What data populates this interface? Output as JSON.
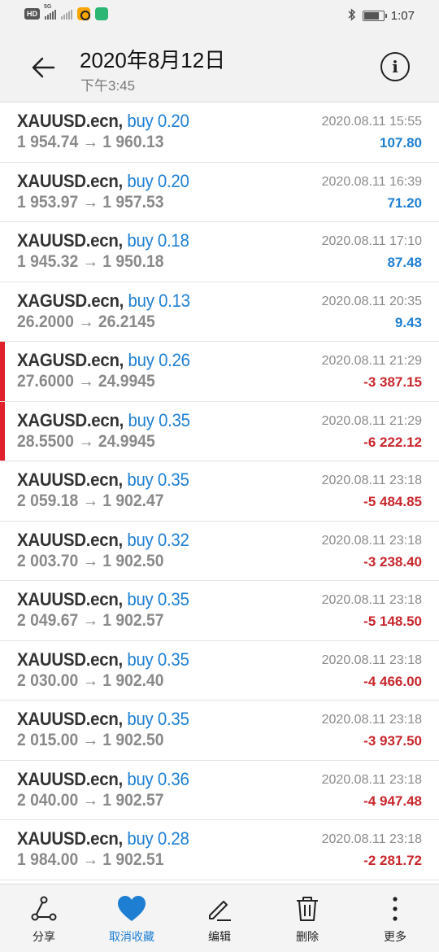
{
  "status_bar": {
    "network_label": "HD",
    "signal_label": "5G",
    "time": "1:07"
  },
  "header": {
    "title": "2020年8月12日",
    "subtitle": "下午3:45"
  },
  "trades": [
    {
      "symbol": "XAUUSD.ecn,",
      "side": "buy 0.20",
      "prices": "1 954.74 → 1 960.13",
      "time": "2020.08.11 15:55",
      "profit": "107.80",
      "positive": true,
      "flag": false
    },
    {
      "symbol": "XAUUSD.ecn,",
      "side": "buy 0.20",
      "prices": "1 953.97 → 1 957.53",
      "time": "2020.08.11 16:39",
      "profit": "71.20",
      "positive": true,
      "flag": false
    },
    {
      "symbol": "XAUUSD.ecn,",
      "side": "buy 0.18",
      "prices": "1 945.32 → 1 950.18",
      "time": "2020.08.11 17:10",
      "profit": "87.48",
      "positive": true,
      "flag": false
    },
    {
      "symbol": "XAGUSD.ecn,",
      "side": "buy 0.13",
      "prices": "26.2000 → 26.2145",
      "time": "2020.08.11 20:35",
      "profit": "9.43",
      "positive": true,
      "flag": false
    },
    {
      "symbol": "XAGUSD.ecn,",
      "side": "buy 0.26",
      "prices": "27.6000 → 24.9945",
      "time": "2020.08.11 21:29",
      "profit": "-3 387.15",
      "positive": false,
      "flag": true
    },
    {
      "symbol": "XAGUSD.ecn,",
      "side": "buy 0.35",
      "prices": "28.5500 → 24.9945",
      "time": "2020.08.11 21:29",
      "profit": "-6 222.12",
      "positive": false,
      "flag": true
    },
    {
      "symbol": "XAUUSD.ecn,",
      "side": "buy 0.35",
      "prices": "2 059.18 → 1 902.47",
      "time": "2020.08.11 23:18",
      "profit": "-5 484.85",
      "positive": false,
      "flag": false
    },
    {
      "symbol": "XAUUSD.ecn,",
      "side": "buy 0.32",
      "prices": "2 003.70 → 1 902.50",
      "time": "2020.08.11 23:18",
      "profit": "-3 238.40",
      "positive": false,
      "flag": false
    },
    {
      "symbol": "XAUUSD.ecn,",
      "side": "buy 0.35",
      "prices": "2 049.67 → 1 902.57",
      "time": "2020.08.11 23:18",
      "profit": "-5 148.50",
      "positive": false,
      "flag": false
    },
    {
      "symbol": "XAUUSD.ecn,",
      "side": "buy 0.35",
      "prices": "2 030.00 → 1 902.40",
      "time": "2020.08.11 23:18",
      "profit": "-4 466.00",
      "positive": false,
      "flag": false
    },
    {
      "symbol": "XAUUSD.ecn,",
      "side": "buy 0.35",
      "prices": "2 015.00 → 1 902.50",
      "time": "2020.08.11 23:18",
      "profit": "-3 937.50",
      "positive": false,
      "flag": false
    },
    {
      "symbol": "XAUUSD.ecn,",
      "side": "buy 0.36",
      "prices": "2 040.00 → 1 902.57",
      "time": "2020.08.11 23:18",
      "profit": "-4 947.48",
      "positive": false,
      "flag": false
    },
    {
      "symbol": "XAUUSD.ecn,",
      "side": "buy 0.28",
      "prices": "1 984.00 → 1 902.51",
      "time": "2020.08.11 23:18",
      "profit": "-2 281.72",
      "positive": false,
      "flag": false
    }
  ],
  "bottom_bar": [
    {
      "label": "分享",
      "icon": "share-icon",
      "active": false
    },
    {
      "label": "取消收藏",
      "icon": "heart-icon",
      "active": true
    },
    {
      "label": "编辑",
      "icon": "edit-icon",
      "active": false
    },
    {
      "label": "删除",
      "icon": "trash-icon",
      "active": false
    },
    {
      "label": "更多",
      "icon": "more-icon",
      "active": false
    }
  ],
  "colors": {
    "positive": "#1e7fd2",
    "negative": "#c8262c",
    "flag": "#e0202b",
    "accent": "#1e7fd2"
  }
}
